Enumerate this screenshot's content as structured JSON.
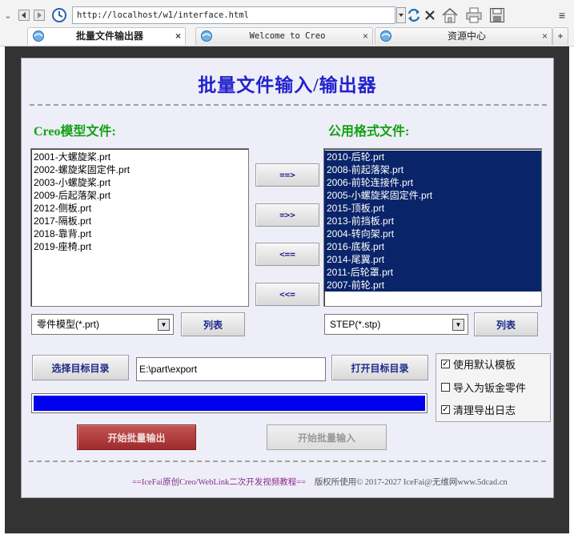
{
  "browser": {
    "url": "http://localhost/w1/interface.html",
    "tabs": [
      {
        "label": "批量文件输出器",
        "active": true
      },
      {
        "label": "Welcome to Creo",
        "active": false
      },
      {
        "label": "资源中心",
        "active": false
      }
    ],
    "new_tab_label": "+"
  },
  "app": {
    "title": "批量文件输入/输出器",
    "left_label": "Creo模型文件:",
    "right_label": "公用格式文件:",
    "left_files": [
      "2001-大螺旋桨.prt",
      "2002-螺旋桨固定件.prt",
      "2003-小螺旋桨.prt",
      "2009-后起落架.prt",
      "2012-侧板.prt",
      "2017-隔板.prt",
      "2018-靠背.prt",
      "2019-座椅.prt"
    ],
    "right_files": [
      "2010-后轮.prt",
      "2008-前起落架.prt",
      "2006-前轮连接件.prt",
      "2005-小螺旋桨固定件.prt",
      "2015-顶板.prt",
      "2013-前挡板.prt",
      "2004-转向架.prt",
      "2016-底板.prt",
      "2014-尾翼.prt",
      "2011-后轮罩.prt",
      "2007-前轮.prt"
    ],
    "arrow_buttons": [
      "==>",
      "=>>",
      "<==",
      "<<="
    ],
    "left_filter": "零件模型(*.prt)",
    "right_filter": "STEP(*.stp)",
    "list_button": "列表",
    "choose_dir_button": "选择目标目录",
    "target_dir": "E:\\part\\export",
    "open_dir_button": "打开目标目录",
    "options": [
      {
        "label": "使用默认模板",
        "checked": true
      },
      {
        "label": "导入为钣金零件",
        "checked": false
      },
      {
        "label": "清理导出日志",
        "checked": true
      }
    ],
    "progress": 1.0,
    "export_button": "开始批量输出",
    "import_button": "开始批量输入",
    "footer_link": "==IceFai原创Creo/WebLink二次开发视频教程==",
    "footer_copyright": "版权所使用© 2017-2027 IceFai@无维网www.5dcad.cn"
  },
  "colors": {
    "title": "#2222cc",
    "section_label": "#13a313",
    "selection": "#0a246a",
    "progress": "#0000ee",
    "export_button": "#a83434"
  }
}
